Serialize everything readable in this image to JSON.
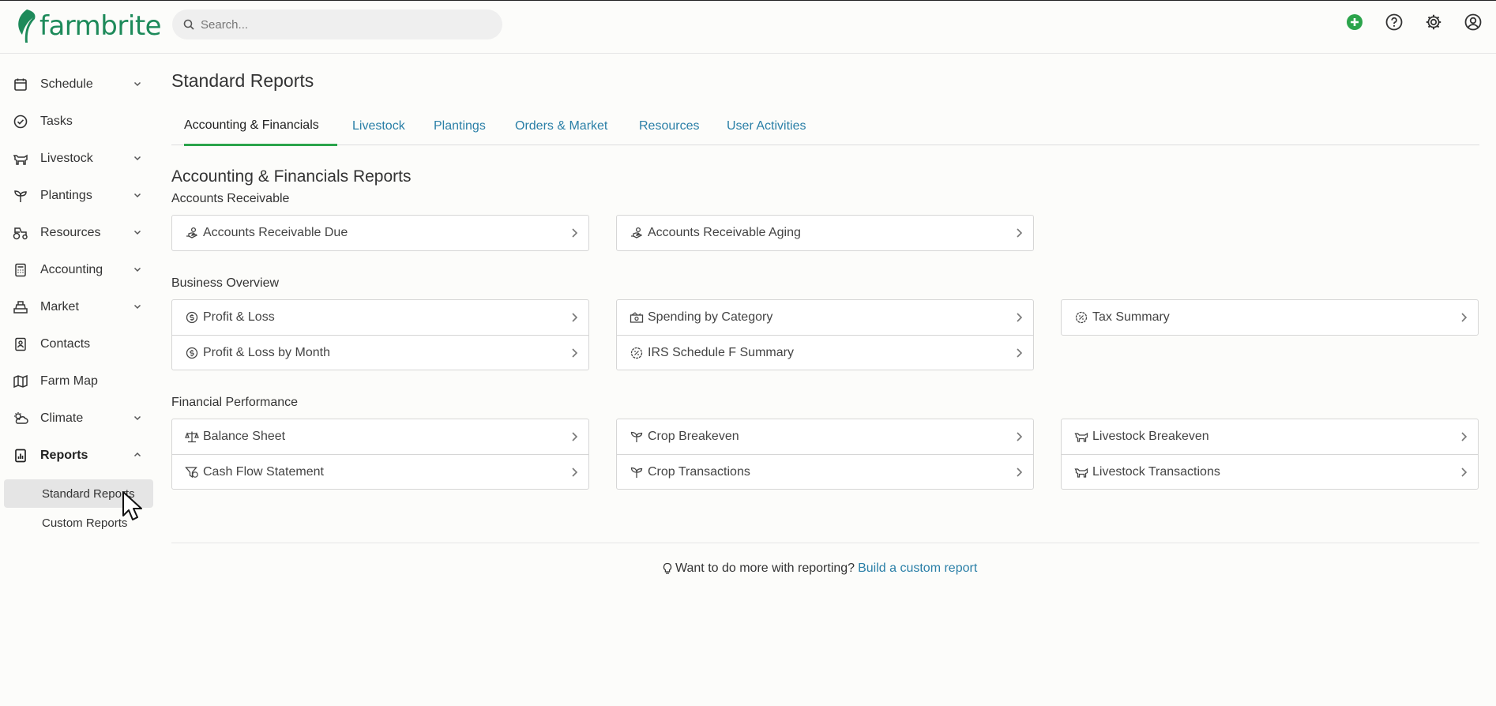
{
  "app": {
    "name": "farmbrite"
  },
  "search": {
    "placeholder": "Search..."
  },
  "sidebar": {
    "items": [
      {
        "label": "Schedule"
      },
      {
        "label": "Tasks"
      },
      {
        "label": "Livestock"
      },
      {
        "label": "Plantings"
      },
      {
        "label": "Resources"
      },
      {
        "label": "Accounting"
      },
      {
        "label": "Market"
      },
      {
        "label": "Contacts"
      },
      {
        "label": "Farm Map"
      },
      {
        "label": "Climate"
      },
      {
        "label": "Reports"
      }
    ],
    "reports_sub": [
      {
        "label": "Standard Reports",
        "selected": true
      },
      {
        "label": "Custom Reports"
      }
    ]
  },
  "main": {
    "title": "Standard Reports",
    "tabs": [
      {
        "label": "Accounting & Financials",
        "active": true
      },
      {
        "label": "Livestock"
      },
      {
        "label": "Plantings"
      },
      {
        "label": "Orders & Market"
      },
      {
        "label": "Resources"
      },
      {
        "label": "User Activities"
      }
    ],
    "section_title": "Accounting & Financials Reports",
    "groups": {
      "accounts_receivable": {
        "label": "Accounts Receivable",
        "col1": [
          "Accounts Receivable Due"
        ],
        "col2": [
          "Accounts Receivable Aging"
        ]
      },
      "business_overview": {
        "label": "Business Overview",
        "col1": [
          "Profit & Loss",
          "Profit & Loss by Month"
        ],
        "col2": [
          "Spending by Category",
          "IRS Schedule F Summary"
        ],
        "col3": [
          "Tax Summary"
        ]
      },
      "financial_performance": {
        "label": "Financial Performance",
        "col1": [
          "Balance Sheet",
          "Cash Flow Statement"
        ],
        "col2": [
          "Crop Breakeven",
          "Crop Transactions"
        ],
        "col3": [
          "Livestock Breakeven",
          "Livestock Transactions"
        ]
      }
    },
    "footer": {
      "text": "Want to do more with reporting?",
      "link": "Build a custom report"
    }
  },
  "colors": {
    "brand": "#1d8a5a",
    "accent_green": "#2ba44b",
    "link": "#2a7fa7"
  }
}
